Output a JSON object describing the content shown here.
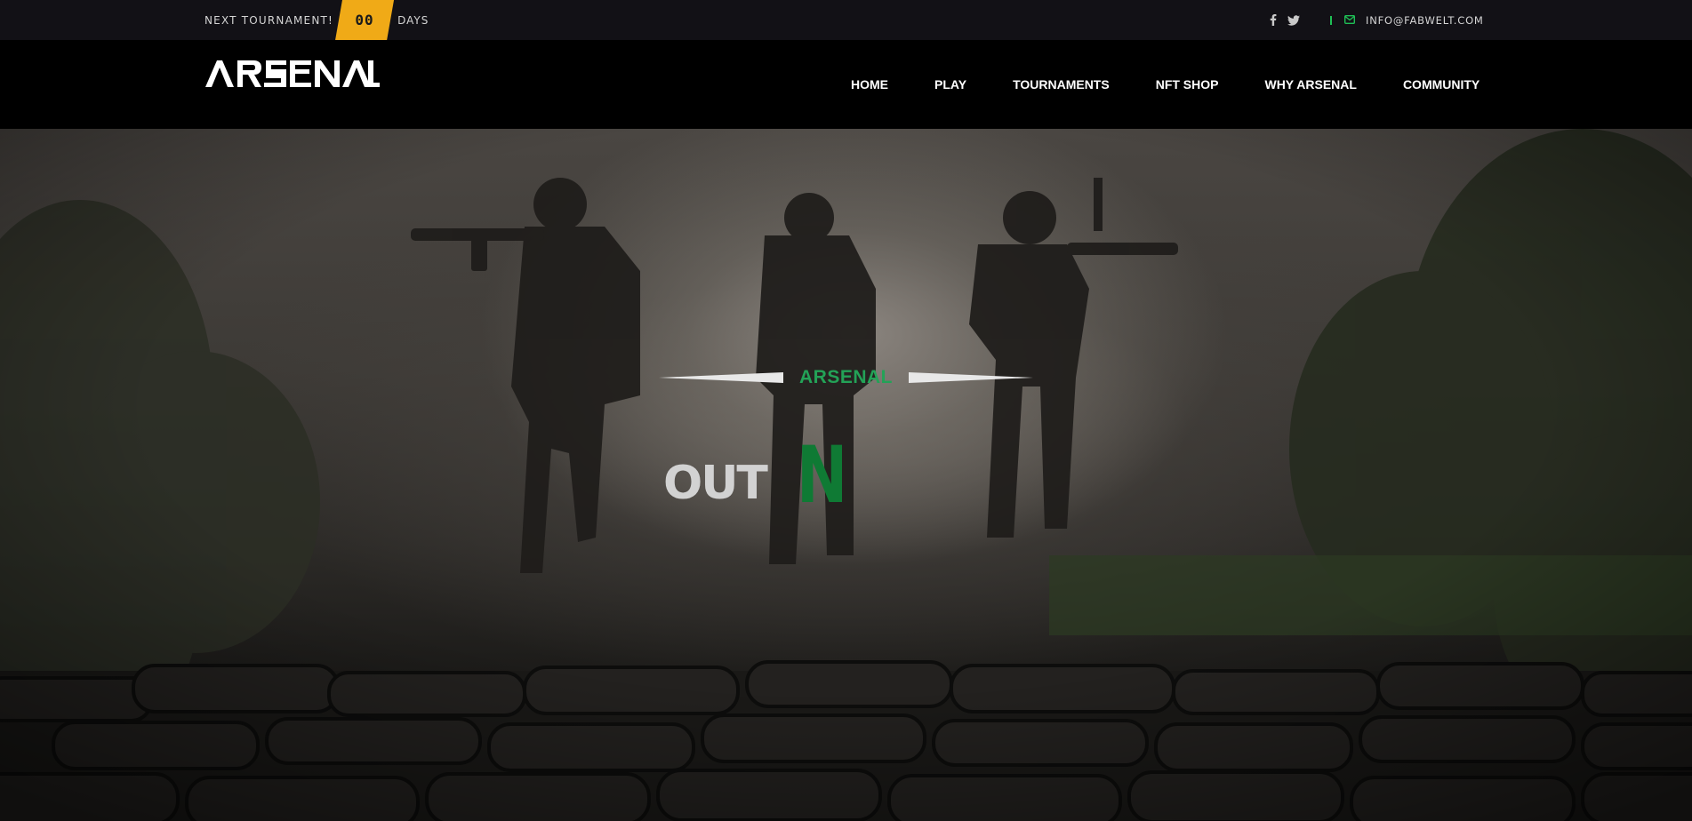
{
  "topbar": {
    "next_label": "NEXT TOURNAMENT!",
    "count_value": "00",
    "days_label": "DAYS",
    "social": [
      {
        "icon": "facebook-icon"
      },
      {
        "icon": "twitter-icon"
      }
    ],
    "email_icon": "envelope-icon",
    "email": "INFO@FABWELT.COM"
  },
  "header": {
    "logo_text": "ARSENAL",
    "nav": [
      {
        "label": "HOME"
      },
      {
        "label": "PLAY"
      },
      {
        "label": "TOURNAMENTS"
      },
      {
        "label": "NFT SHOP"
      },
      {
        "label": "WHY ARSENAL"
      },
      {
        "label": "COMMUNITY"
      }
    ]
  },
  "hero": {
    "subtitle": "ARSENAL",
    "headline_part1": "OUT",
    "headline_part2": "N"
  },
  "colors": {
    "accent_green": "#23a257",
    "countdown_yellow": "#f0aa17",
    "topbar_bg": "#121116",
    "header_bg": "#000000"
  }
}
